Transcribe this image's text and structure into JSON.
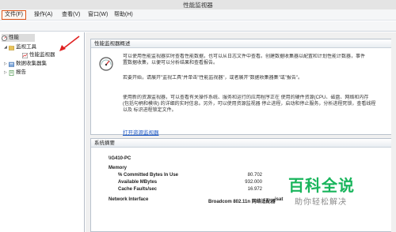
{
  "window": {
    "title": "性能监视器"
  },
  "menu": [
    {
      "label": "文件(F)",
      "active": true
    },
    {
      "label": "操作(A)"
    },
    {
      "label": "查看(V)"
    },
    {
      "label": "窗口(W)"
    },
    {
      "label": "帮助(H)"
    }
  ],
  "tree": {
    "root": "性能",
    "monitoring_tools": "监视工具",
    "performance_monitor": "性能监视器",
    "data_collector_sets": "数据收集器集",
    "reports": "报告"
  },
  "overview": {
    "header": "性能监视器概述",
    "p1_lines": [
      "可以使用性能监视器实时查看性能数据，也可以从日志文件中查看。创建数据收集器以配置和计划性能计数器，事件",
      "置数据收集，以便可以分析结果和查看报告。"
    ],
    "p2_lines": [
      "若要开始，请展开\"监视工具\"并单击\"性能监视器\"，或者展开\"数据收集器集\"或\"报告\"。"
    ],
    "p3_lines": [
      "使用新的资源监视器，可以查看有关操作系统、服务和运行的应用程序正在 使用的硬件资源(CPU、磁盘、网络和内存",
      "(包括句柄和模块) 的详细的实时信息。另外，可以使用资源监视器 停止进程，启动和停止服务，分析进程死锁，查看线程",
      "以及 标识进程锁定文件。"
    ],
    "link": "打开资源监视器"
  },
  "summary": {
    "header": "系统摘要",
    "computer": "\\\\G410-PC",
    "memory_label": "Memory",
    "rows": [
      {
        "name": "% Committed Bytes In Use",
        "value": "80.702"
      },
      {
        "name": "Available MBytes",
        "value": "932.000"
      },
      {
        "name": "Cache Faults/sec",
        "value": "16.972"
      }
    ],
    "network_label": "Network Interface",
    "network_adapter": "Broadcom 802.11n 网络适配器",
    "network_other": "isat"
  },
  "watermark": {
    "title": "百科全说",
    "subtitle": "助你轻松解决"
  },
  "colors": {
    "accent": "#e0561a",
    "link": "#1a56c4",
    "watermark": "#19b55c",
    "arrow": "#e02020"
  }
}
